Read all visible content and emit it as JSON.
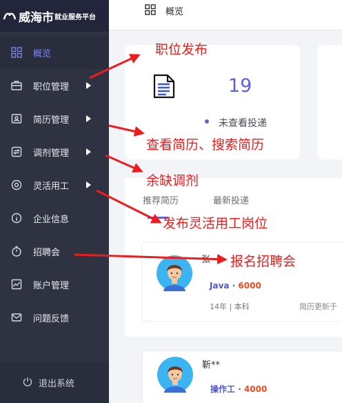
{
  "sidebar": {
    "logo_city": "威海市",
    "logo_sub": "就业服务平台",
    "items": [
      {
        "label": "概览",
        "icon": "dashboard-grid-icon",
        "active": true,
        "expandable": false
      },
      {
        "label": "职位管理",
        "icon": "briefcase-icon",
        "active": false,
        "expandable": true
      },
      {
        "label": "简历管理",
        "icon": "resume-icon",
        "active": false,
        "expandable": true
      },
      {
        "label": "调剂管理",
        "icon": "swap-icon",
        "active": false,
        "expandable": true
      },
      {
        "label": "灵活用工",
        "icon": "target-icon",
        "active": false,
        "expandable": true
      },
      {
        "label": "企业信息",
        "icon": "info-icon",
        "active": false,
        "expandable": false
      },
      {
        "label": "招聘会",
        "icon": "timer-icon",
        "active": false,
        "expandable": false
      },
      {
        "label": "账户管理",
        "icon": "chart-icon",
        "active": false,
        "expandable": false
      },
      {
        "label": "问题反馈",
        "icon": "mail-icon",
        "active": false,
        "expandable": false
      }
    ],
    "logout_label": "退出系统"
  },
  "header": {
    "title": "概览"
  },
  "stats": {
    "value": "19",
    "label": "未查看投递"
  },
  "tabs": [
    "推荐简历",
    "最新投递"
  ],
  "resumes": [
    {
      "name": "张",
      "job": "Java",
      "salary": "6000",
      "meta": "14年 | 本科",
      "updated": "简历更新于"
    },
    {
      "name": "靳**",
      "job": "操作工",
      "salary": "4000"
    }
  ],
  "annotations": [
    "职位发布",
    "查看简历、搜索简历",
    "余缺调剂",
    "发布灵活用工岗位",
    "报名招聘会"
  ],
  "colors": {
    "annotation": "#ee1c1c",
    "accent": "#5a63d8",
    "sidebar": "#2f3241",
    "salary": "#ee4c22"
  }
}
